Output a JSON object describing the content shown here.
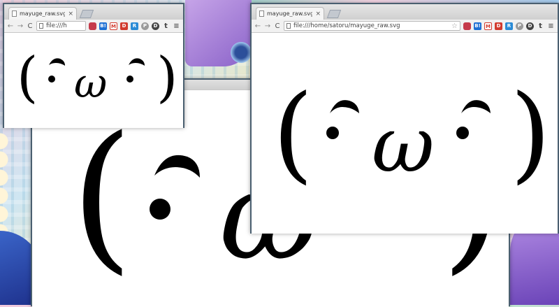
{
  "windows": {
    "small": {
      "tab_title": "mayuge_raw.svg",
      "url": "file:///h"
    },
    "background": {},
    "main": {
      "tab_title": "mayuge_raw.svg",
      "url": "file:///home/satoru/mayuge_raw.svg"
    }
  },
  "icons": {
    "close": "×",
    "back": "←",
    "forward": "→",
    "reload": "C",
    "star": "☆",
    "menu": "≡"
  },
  "extensions": [
    "pocket-icon",
    "b!-icon",
    "gmail-icon",
    "dialog-icon",
    "feedly-icon",
    "p-icon",
    "circle-icon",
    "tumblr-icon",
    "menu-icon"
  ],
  "extension_labels": [
    "",
    "B!",
    "M",
    "D",
    "R",
    "P",
    "D",
    "t",
    "≡"
  ],
  "kaomoji": {
    "open_paren": "(",
    "close_paren": ")",
    "eye": "•",
    "brow": "ᵔ",
    "mouth": "ω"
  },
  "colors": {
    "window_border": "#4a5f70",
    "ink": "#000000"
  }
}
